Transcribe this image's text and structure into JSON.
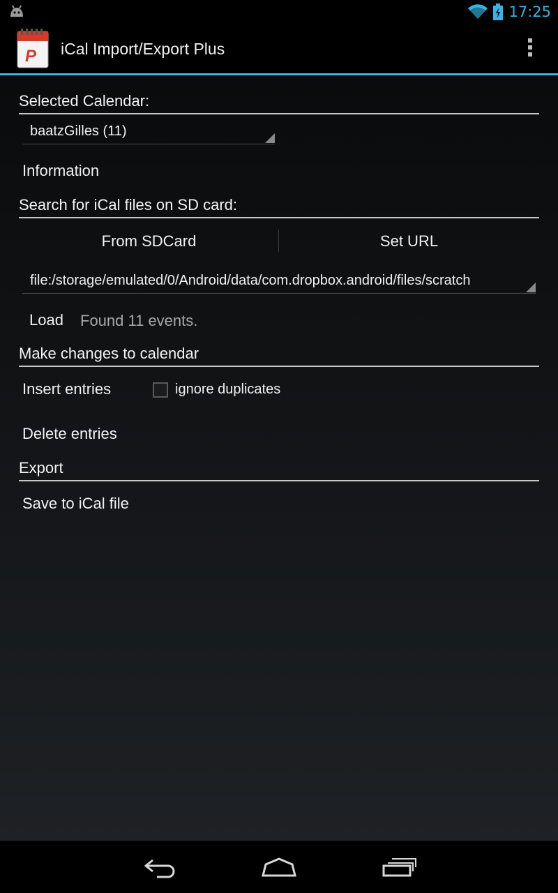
{
  "status_bar": {
    "time": "17:25",
    "left_icon": "android-debug-icon",
    "icons": [
      "wifi-icon",
      "battery-charging-icon"
    ],
    "accent_color": "#33b5e5"
  },
  "action_bar": {
    "title": "iCal Import/Export Plus",
    "app_icon_letter": "P",
    "overflow_icon": "overflow-menu-icon"
  },
  "sections": {
    "selected_calendar": {
      "header": "Selected Calendar:",
      "spinner_value": "baatzGilles (11)",
      "information_label": "Information"
    },
    "search": {
      "header": "Search for iCal files on SD card:",
      "from_sdcard_label": "From SDCard",
      "set_url_label": "Set URL",
      "file_spinner_value": "file:/storage/emulated/0/Android/data/com.dropbox.android/files/scratch",
      "load_label": "Load",
      "status": "Found 11 events."
    },
    "changes": {
      "header": "Make changes to calendar",
      "insert_label": "Insert entries",
      "ignore_duplicates_label": "ignore duplicates",
      "ignore_duplicates_checked": false,
      "delete_label": "Delete entries"
    },
    "export": {
      "header": "Export",
      "save_label": "Save to iCal file"
    }
  },
  "nav_bar": {
    "buttons": [
      "back-icon",
      "home-icon",
      "recent-apps-icon"
    ]
  }
}
